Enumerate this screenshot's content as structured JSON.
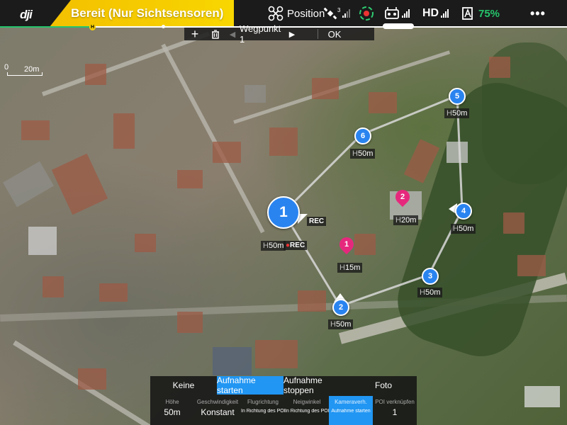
{
  "app": {
    "logo_text": "dji"
  },
  "status": {
    "text": "Bereit (Nur Sichtsensoren)",
    "color": "#f5c800"
  },
  "topbar": {
    "flight_mode": "Position",
    "gps_count": "3",
    "video_quality": "HD",
    "battery_percent": "75%",
    "battery_color": "#25c46b",
    "menu_label": "•••",
    "icons": [
      "drone-icon",
      "satellite-icon",
      "obstacle-icon",
      "remote-controller-icon",
      "battery-icon",
      "menu-icon"
    ]
  },
  "home_marker": "H",
  "waypoint_toolbar": {
    "add": "+",
    "delete": "🗑",
    "waypoint_label": "Wegpunkt 1",
    "play": "▶",
    "ok": "OK"
  },
  "map": {
    "scale_label": "20m",
    "waypoints": [
      {
        "number": "1",
        "height": "50m",
        "rec": "REC"
      },
      {
        "number": "2",
        "height": "50m"
      },
      {
        "number": "3",
        "height": "50m"
      },
      {
        "number": "4",
        "height": "50m"
      },
      {
        "number": "5",
        "height": "50m"
      },
      {
        "number": "6",
        "height": "50m"
      }
    ],
    "second_rec": "REC",
    "pois": [
      {
        "number": "1",
        "height": "15m"
      },
      {
        "number": "2",
        "height": "20m"
      }
    ],
    "height_prefix": "H"
  },
  "action_panel": {
    "tabs": [
      "Keine",
      "Aufnahme starten",
      "Aufnahme stoppen",
      "Foto"
    ],
    "active_tab": 1,
    "params": [
      {
        "caption": "Höhe",
        "value": "50m"
      },
      {
        "caption": "Geschwindigkeit",
        "value": "Konstant"
      },
      {
        "caption": "Flugrichtung",
        "value": "In Richtung des POI"
      },
      {
        "caption": "Neigwinkel",
        "value": "In Richtung des POI"
      },
      {
        "caption": "Kameraverh.",
        "value": "Aufnahme starten"
      },
      {
        "caption": "POI verknüpfen",
        "value": "1"
      }
    ]
  }
}
